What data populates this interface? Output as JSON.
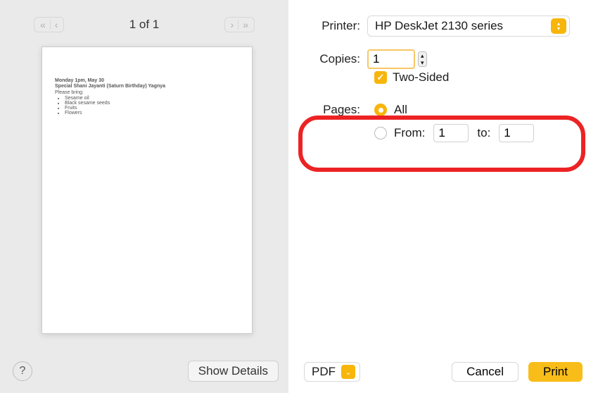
{
  "nav": {
    "page_counter": "1 of 1"
  },
  "preview": {
    "date": "Monday 1pm, May 30",
    "title": "Special Shani Jayanti (Saturn Birthday) Yagnya",
    "intro": "Please bring:",
    "items": [
      "Sesame oil",
      "Black sesame seeds",
      "Fruits",
      "Flowers"
    ]
  },
  "left_footer": {
    "help": "?",
    "details": "Show Details"
  },
  "form": {
    "printer_label": "Printer:",
    "printer_value": "HP DeskJet 2130 series",
    "copies_label": "Copies:",
    "copies_value": "1",
    "two_sided": "Two-Sided",
    "pages_label": "Pages:",
    "pages_all": "All",
    "pages_from_label": "From:",
    "pages_from": "1",
    "pages_to_label": "to:",
    "pages_to": "1"
  },
  "footer": {
    "pdf": "PDF",
    "cancel": "Cancel",
    "print": "Print"
  },
  "colors": {
    "accent": "#f8b50a",
    "highlight_ring": "#ec2324"
  }
}
